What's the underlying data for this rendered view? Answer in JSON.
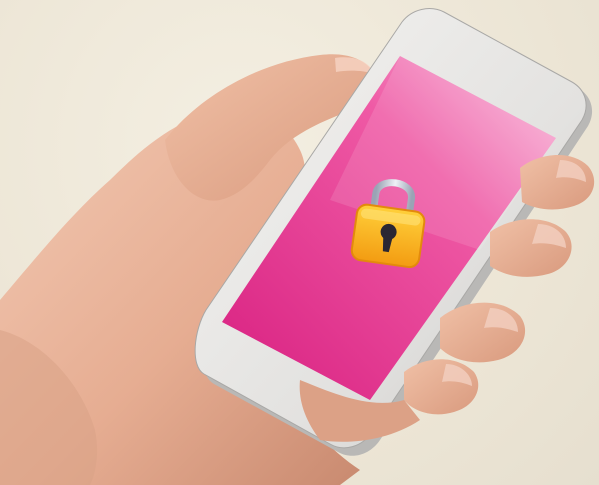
{
  "scene": {
    "subject": "hand-holding-phone",
    "screen_icon": "padlock-icon",
    "colors": {
      "background": "#efe9da",
      "screen_pink": "#e8388f",
      "screen_light": "#f7b3d6",
      "phone_body": "#e9e8e6",
      "lock_gold": "#f6b21f",
      "skin": "#e8b39a"
    }
  }
}
